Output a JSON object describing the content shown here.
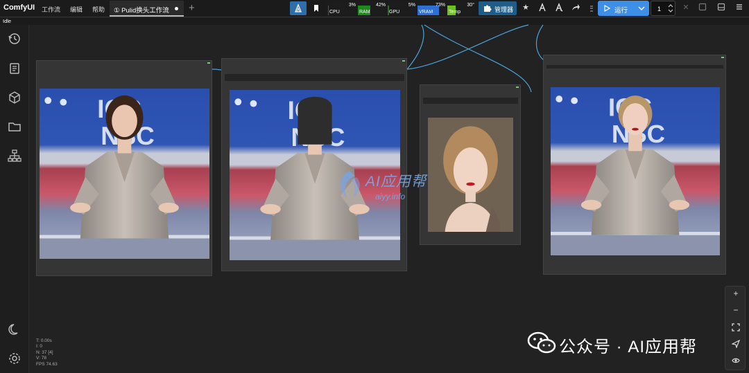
{
  "app": {
    "title": "ComfyUI",
    "status": "Idle"
  },
  "menu": {
    "workflow": "工作流",
    "edit": "编辑",
    "help": "帮助"
  },
  "tab": {
    "label": "① Pulid换头工作流",
    "add": "+"
  },
  "monitors": [
    {
      "label": "CPU",
      "pct": "3%",
      "color": "#2d6c2d"
    },
    {
      "label": "RAM",
      "pct": "42%",
      "color": "#1e8a1e"
    },
    {
      "label": "GPU",
      "pct": "5%",
      "color": "#2d6c2d"
    },
    {
      "label": "VRAM",
      "pct": "73%",
      "color": "#2e6fd6"
    },
    {
      "label": "Temp",
      "pct": "30°",
      "color": "#6cc11a"
    }
  ],
  "toolbar": {
    "manager": "管理器",
    "run": "运行",
    "queue_count": "1"
  },
  "stats": {
    "t": "T: 0.00s",
    "i": "I: 0",
    "n": "N: 37 [4]",
    "v": "V: 78",
    "fps": "FPS 74.63"
  },
  "watermark": {
    "main": "AI应用帮",
    "sub": "aiyy.info"
  },
  "footer_watermark": "公众号 · AI应用帮",
  "zoom_controls": {
    "zoom_in": "+",
    "zoom_out": "−"
  },
  "colors": {
    "accent": "#3d8fe8",
    "manager": "#1f5d86",
    "node": "#353535",
    "link": "#4aa3d8"
  },
  "icons": [
    "history-icon",
    "document-icon",
    "cube-icon",
    "folder-icon",
    "workflow-tree-icon",
    "moon-icon",
    "settings-icon"
  ]
}
